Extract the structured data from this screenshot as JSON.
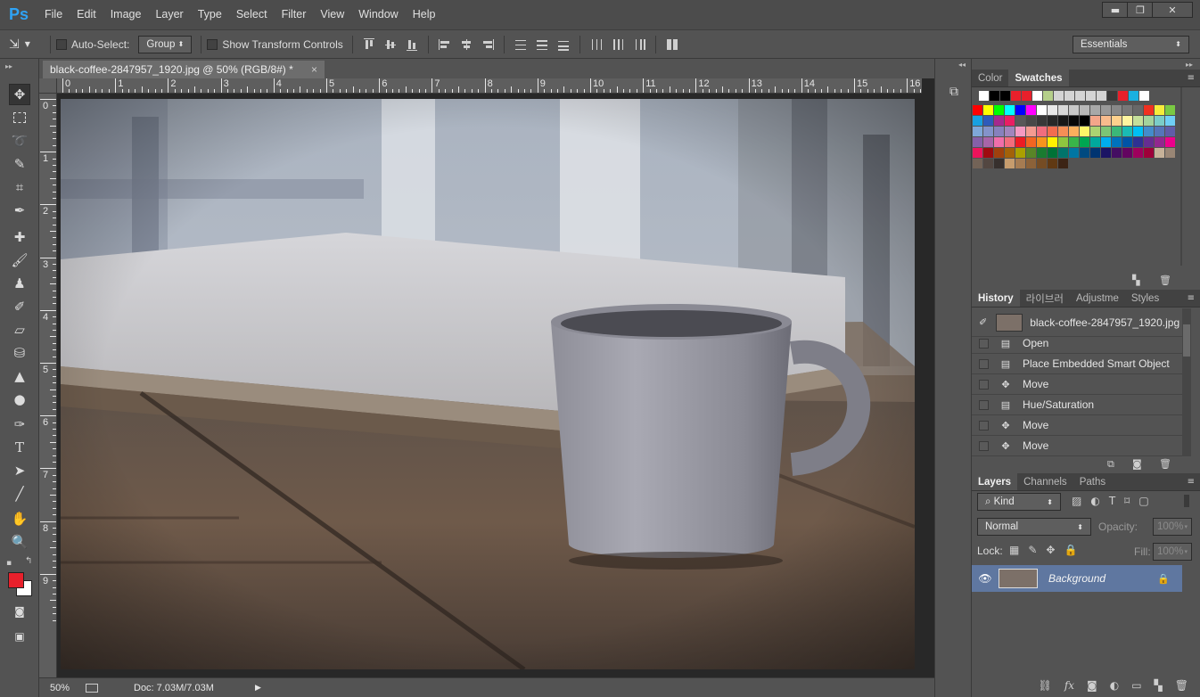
{
  "app": {
    "logo": "Ps"
  },
  "menu": [
    "File",
    "Edit",
    "Image",
    "Layer",
    "Type",
    "Select",
    "Filter",
    "View",
    "Window",
    "Help"
  ],
  "window_controls": {
    "minimize": "▬",
    "restore": "❐",
    "close": "✕"
  },
  "options": {
    "auto_select_label": "Auto-Select:",
    "auto_select_value": "Group",
    "show_transform_label": "Show Transform Controls",
    "workspace_value": "Essentials"
  },
  "document": {
    "tab_title": "black-coffee-2847957_1920.jpg @ 50% (RGB/8#) *",
    "close": "×",
    "ruler_h": [
      "0",
      "1",
      "2",
      "3",
      "4",
      "5",
      "6",
      "7",
      "8",
      "9",
      "10",
      "11",
      "12",
      "13",
      "14",
      "15",
      "16"
    ],
    "ruler_v": [
      "0",
      "1",
      "2",
      "3",
      "4",
      "5",
      "6",
      "7",
      "8",
      "9"
    ]
  },
  "status": {
    "zoom": "50%",
    "doc_info": "Doc: 7.03M/7.03M"
  },
  "swatch_panel": {
    "tabs": [
      "Color",
      "Swatches"
    ],
    "active_tab": "Swatches",
    "recent": [
      "#ffffff",
      "#000000",
      "#000000",
      "#e8202b",
      "#e8202b",
      "#ffffff",
      "#b5cf8a",
      "#d4d4d4",
      "#d4d4d4",
      "#d4d4d4",
      "#d4d4d4",
      "#d4d4d4",
      "#3a3a3a",
      "#e8202b",
      "#1ab0e0",
      "#ffffff"
    ],
    "grid": [
      [
        "#ff0000",
        "#ffff00",
        "#00ff00",
        "#00ffff",
        "#0000ff",
        "#ff00ff",
        "#ffffff",
        "#e8e8e8",
        "#d8d8d8",
        "#c8c8c8",
        "#b8b8b8",
        "#a8a8a8",
        "#989898",
        "#888888",
        "#787878",
        "#686868",
        "#f03020",
        "#f7ec3a",
        "#7ac943"
      ],
      [
        "#18a0e0",
        "#2e5bba",
        "#a5298e",
        "#ea1e63",
        "#585858",
        "#484848",
        "#383838",
        "#282828",
        "#181818",
        "#080808",
        "#000000",
        "#f4a68a",
        "#f7bb8d",
        "#fdd18d",
        "#fff5a0",
        "#c5df9a",
        "#a3d39c",
        "#7bcdc8",
        "#6fcff6"
      ],
      [
        "#7ea7d8",
        "#8493ca",
        "#8781bd",
        "#a185bd",
        "#f49ac2",
        "#f39b91",
        "#f16d7e",
        "#f26c4f",
        "#f68e56",
        "#fbaf5d",
        "#fff568",
        "#acd372",
        "#7cc576",
        "#3bb878",
        "#1abbb4",
        "#00bff3",
        "#438ccb",
        "#5574b9",
        "#605ca8"
      ],
      [
        "#8560a8",
        "#a864a8",
        "#f06eaa",
        "#f26d7d",
        "#ed1c24",
        "#f26522",
        "#f7941d",
        "#fff200",
        "#8dc63f",
        "#39b54a",
        "#00a651",
        "#00a99d",
        "#00aeef",
        "#0072bc",
        "#0054a6",
        "#2e3192",
        "#662d91",
        "#92278f",
        "#ec008c"
      ],
      [
        "#ed145b",
        "#9e0b0f",
        "#a0410d",
        "#a36209",
        "#aba000",
        "#598527",
        "#1a7b30",
        "#007236",
        "#00746b",
        "#0076a3",
        "#004a80",
        "#003471",
        "#1b1464",
        "#440e62",
        "#630460",
        "#9e005d",
        "#9e0039",
        "#c7b299",
        "#998675"
      ],
      [
        "#736357",
        "#534741",
        "#37302d",
        "#c69c6d",
        "#a67c52",
        "#8c6239",
        "#754c24",
        "#603913",
        "#3c2415"
      ]
    ]
  },
  "history_panel": {
    "tabs": [
      "History",
      "라이브러",
      "Adjustme",
      "Styles"
    ],
    "active_tab": "History",
    "snapshot": "black-coffee-2847957_1920.jpg",
    "items": [
      "Open",
      "Place Embedded Smart Object",
      "Move",
      "Hue/Saturation",
      "Move",
      "Move"
    ]
  },
  "layers_panel": {
    "tabs": [
      "Layers",
      "Channels",
      "Paths"
    ],
    "active_tab": "Layers",
    "filter": "Kind",
    "blend_mode": "Normal",
    "opacity_label": "Opacity:",
    "opacity_value": "100%",
    "lock_label": "Lock:",
    "fill_label": "Fill:",
    "fill_value": "100%",
    "layer_name": "Background"
  },
  "colors": {
    "foreground": "#e8202b",
    "background": "#ffffff",
    "selected_layer": "#5f77a0"
  }
}
